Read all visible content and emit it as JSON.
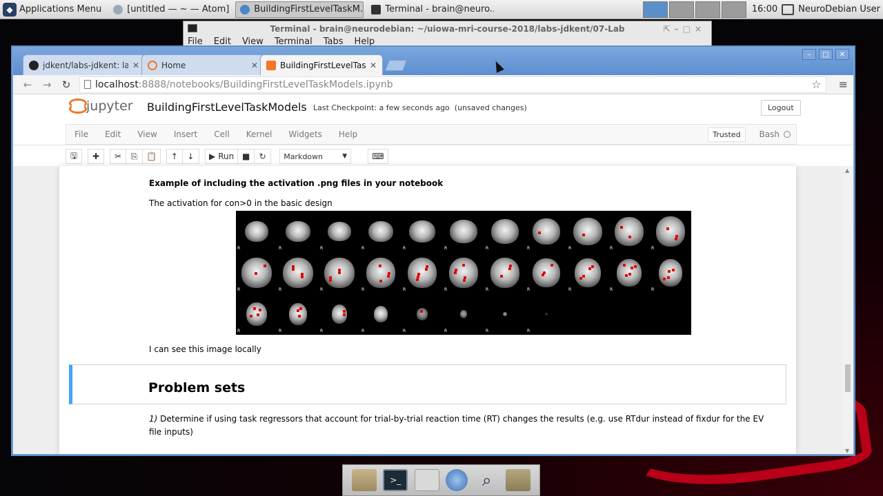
{
  "taskbar": {
    "apps_menu": "Applications Menu",
    "tasks": [
      {
        "label": "[untitled — ~ — Atom]",
        "active": false
      },
      {
        "label": "BuildingFirstLevelTaskM...",
        "active": true
      },
      {
        "label": "Terminal - brain@neuro...",
        "active": false
      }
    ],
    "clock": "16:00",
    "user": "NeuroDebian User"
  },
  "terminal": {
    "title": "Terminal - brain@neurodebian: ~/uiowa-mri-course-2018/labs-jdkent/07-Lab",
    "menu": [
      "File",
      "Edit",
      "View",
      "Terminal",
      "Tabs",
      "Help"
    ]
  },
  "browser": {
    "tabs": [
      {
        "label": "jdkent/labs-jdkent: lab",
        "icon": "github-icon",
        "active": false
      },
      {
        "label": "Home",
        "icon": "loading-icon",
        "active": false
      },
      {
        "label": "BuildingFirstLevelTask",
        "icon": "notebook-icon",
        "active": true
      }
    ],
    "url_host": "localhost",
    "url_path": ":8888/notebooks/BuildingFirstLevelTaskModels.ipynb"
  },
  "jupyter": {
    "logo_text": "jupyter",
    "notebook_title": "BuildingFirstLevelTaskModels",
    "checkpoint": "Last Checkpoint: a few seconds ago",
    "unsaved": "(unsaved changes)",
    "logout": "Logout",
    "menu": [
      "File",
      "Edit",
      "View",
      "Insert",
      "Cell",
      "Kernel",
      "Widgets",
      "Help"
    ],
    "trusted": "Trusted",
    "kernel_name": "Bash",
    "run_label": "Run",
    "cell_type": "Markdown"
  },
  "notebook": {
    "heading": "Example of including the activation .png files in your notebook",
    "caption": "The activation for con>0 in the basic design",
    "after_image": "I can see this image locally",
    "problem_heading": "Problem sets",
    "q1_number": "1)",
    "q1_text": " Determine if using task regressors that account for trial-by-trial reaction time (RT) changes the results (e.g. use RTdur instead of fixdur for the EV file inputs)"
  },
  "colors": {
    "jupyter_orange": "#f37726",
    "selected_cell": "#42a5f5",
    "browser_chrome": "#5d8ed1",
    "activation": "#e00000"
  }
}
